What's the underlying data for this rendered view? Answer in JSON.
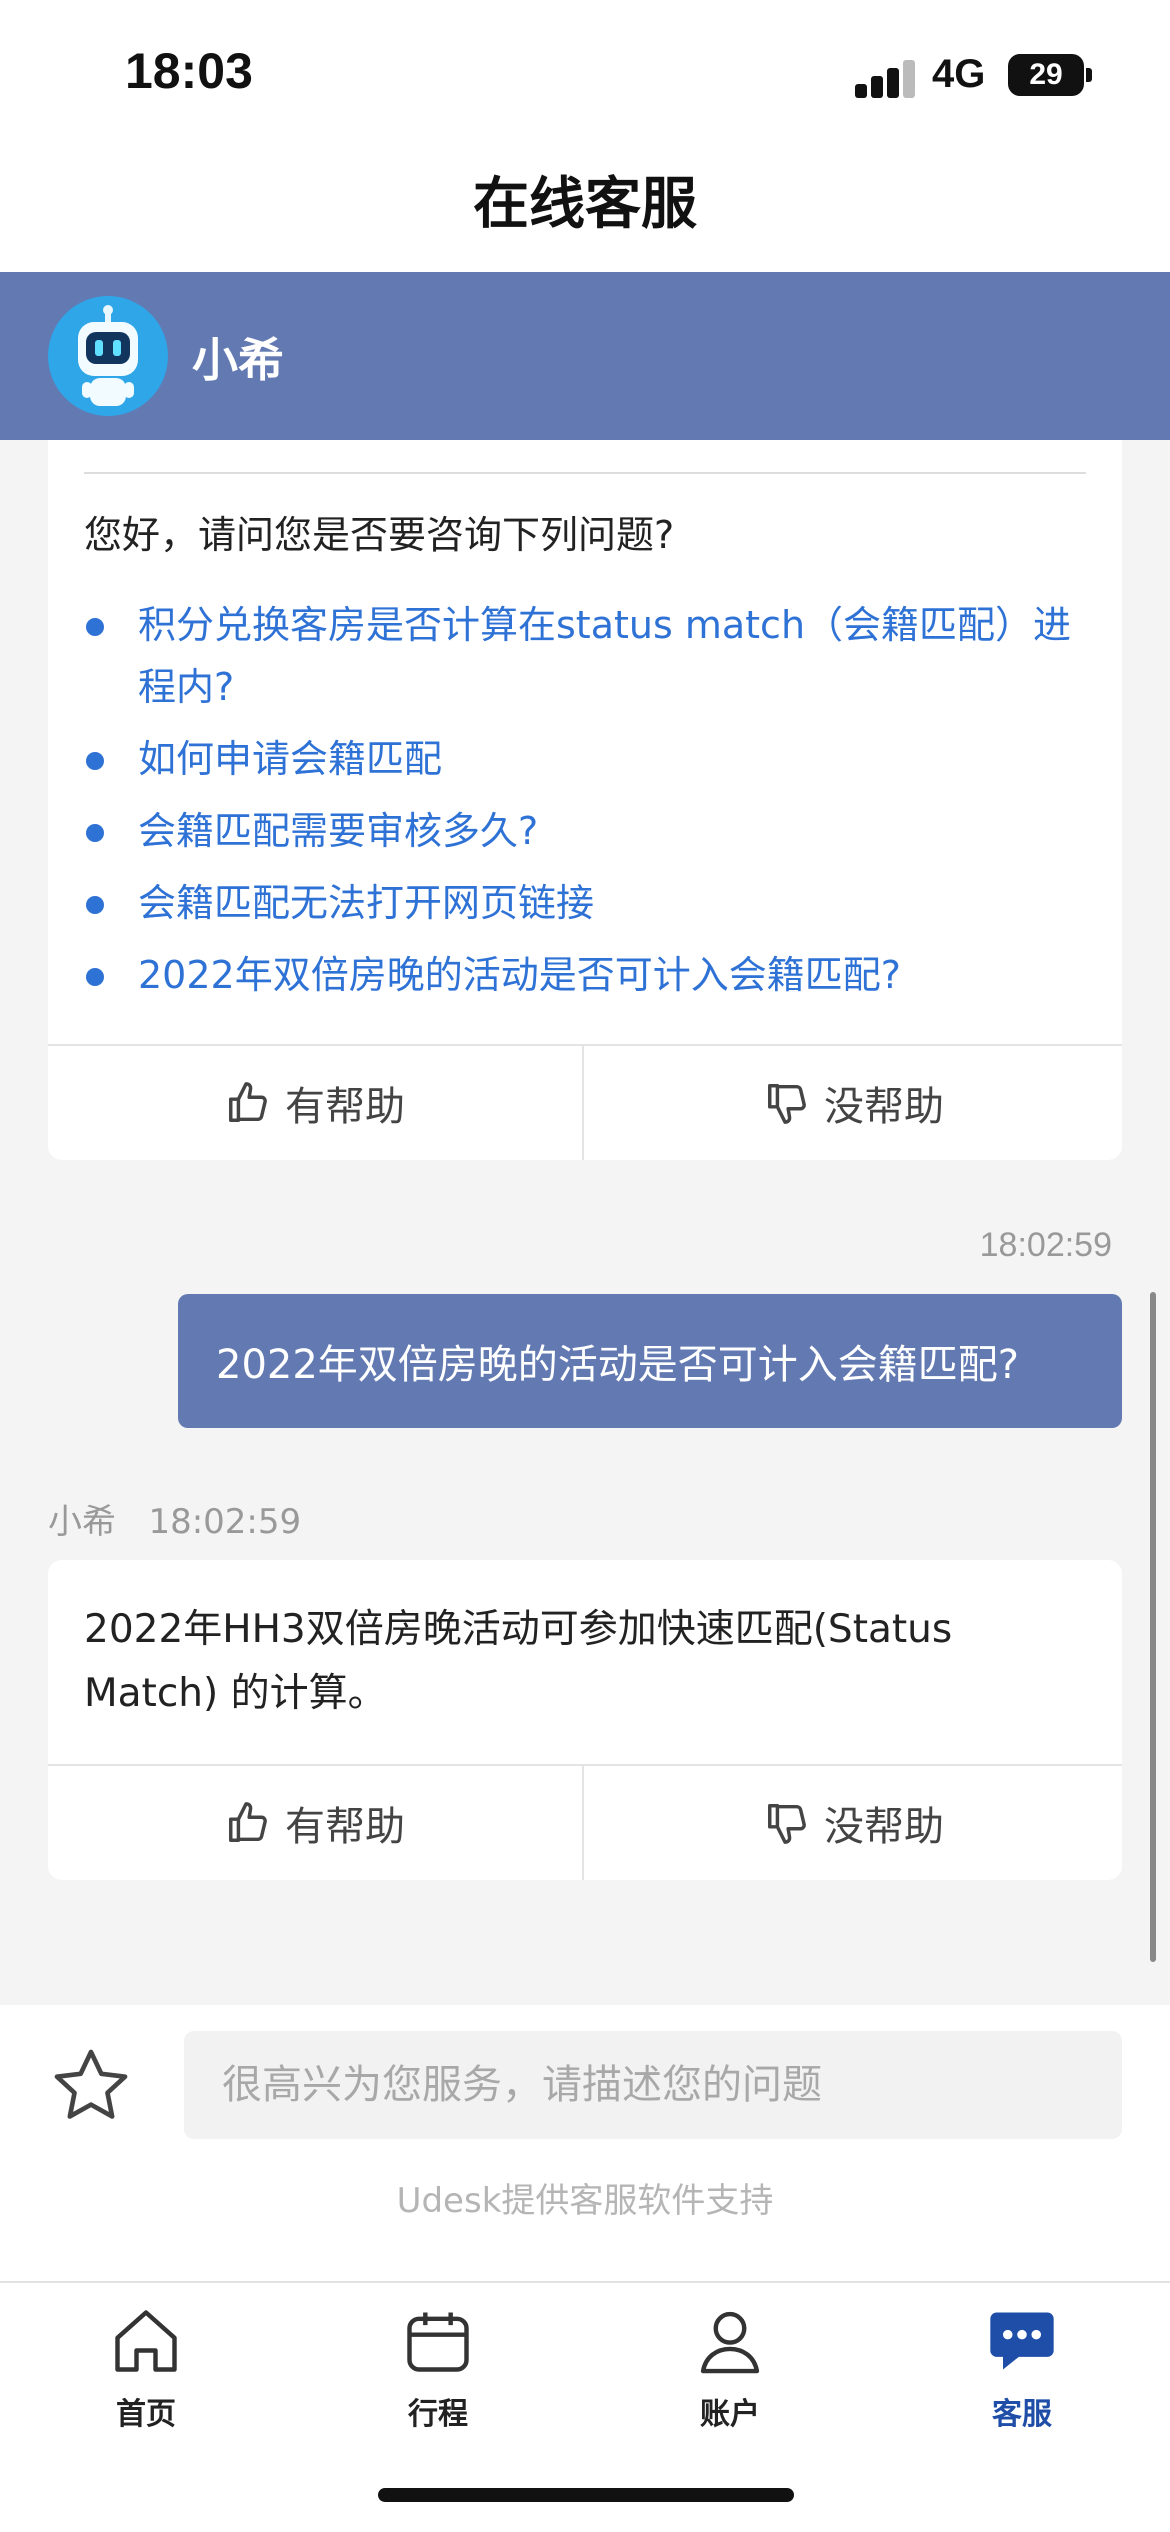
{
  "status_bar": {
    "time": "18:03",
    "network": "4G",
    "battery": "29"
  },
  "title": "在线客服",
  "agent": {
    "name": "小希"
  },
  "suggestion_card": {
    "greeting": "您好，请问您是否要咨询下列问题?",
    "questions": [
      "积分兑换客房是否计算在status match（会籍匹配）进程内?",
      "如何申请会籍匹配",
      "会籍匹配需要审核多久?",
      "会籍匹配无法打开网页链接",
      "2022年双倍房晚的活动是否可计入会籍匹配?"
    ],
    "helpful_label": "有帮助",
    "unhelpful_label": "没帮助"
  },
  "user_message": {
    "time": "18:02:59",
    "text": "2022年双倍房晚的活动是否可计入会籍匹配?"
  },
  "bot_reply": {
    "sender": "小希",
    "time": "18:02:59",
    "text": "2022年HH3双倍房晚活动可参加快速匹配(Status Match) 的计算。",
    "helpful_label": "有帮助",
    "unhelpful_label": "没帮助"
  },
  "composer": {
    "placeholder": "很高兴为您服务，请描述您的问题",
    "powered_by": "Udesk提供客服软件支持"
  },
  "tabs": [
    {
      "label": "首页",
      "icon": "home-icon"
    },
    {
      "label": "行程",
      "icon": "calendar-icon"
    },
    {
      "label": "账户",
      "icon": "user-icon"
    },
    {
      "label": "客服",
      "icon": "chat-icon",
      "active": true
    }
  ],
  "colors": {
    "header": "#6279b1",
    "link": "#2f72d6",
    "active_tab": "#1e4ea8"
  }
}
